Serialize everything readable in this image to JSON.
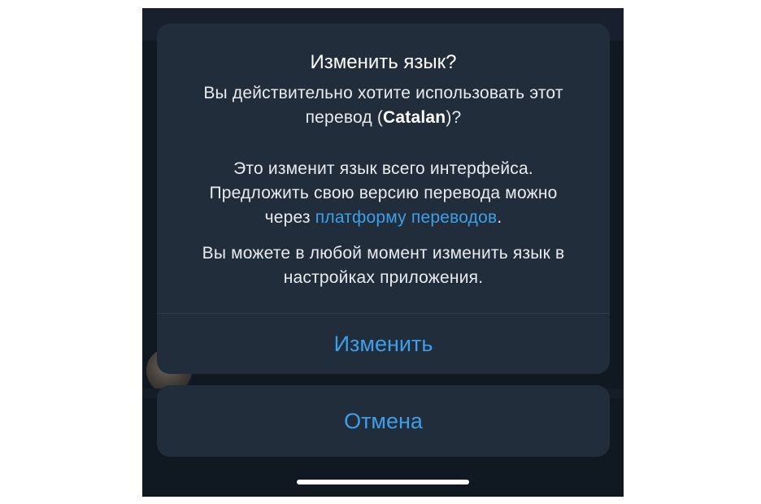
{
  "dialog": {
    "title": "Изменить язык?",
    "paragraph1": {
      "line1": "Вы действительно хотите использовать этот",
      "line2_pre": "перевод (",
      "language": "Catalan",
      "line2_post": ")?"
    },
    "paragraph2": {
      "line1": "Это изменит язык всего интерфейса.",
      "line2": "Предложить свою версию перевода можно",
      "line3_pre": "через ",
      "link": "платформу переводов",
      "line3_post": "."
    },
    "paragraph3": {
      "line1": "Вы можете в любой момент изменить язык в",
      "line2": "настройках приложения."
    },
    "confirm_label": "Изменить"
  },
  "cancel_label": "Отмена",
  "colors": {
    "accent": "#3e9fe8",
    "sheet": "#212d3b",
    "background": "#101822"
  }
}
